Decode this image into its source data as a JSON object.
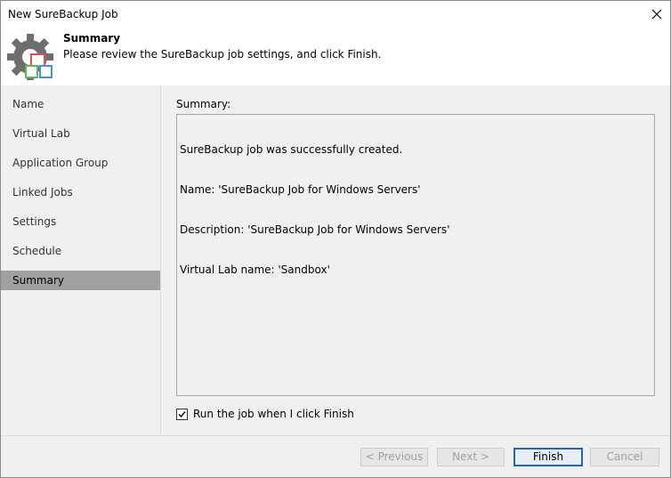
{
  "window": {
    "title": "New SureBackup Job"
  },
  "header": {
    "title": "Summary",
    "subtitle": "Please review the SureBackup job settings, and click Finish."
  },
  "sidebar": {
    "steps": [
      {
        "label": "Name"
      },
      {
        "label": "Virtual Lab"
      },
      {
        "label": "Application Group"
      },
      {
        "label": "Linked Jobs"
      },
      {
        "label": "Settings"
      },
      {
        "label": "Schedule"
      },
      {
        "label": "Summary",
        "active": true
      }
    ]
  },
  "main": {
    "summary_label": "Summary:",
    "summary_lines": [
      "SureBackup job was successfully created.",
      "Name: 'SureBackup Job for Windows Servers'",
      "Description: 'SureBackup Job for Windows Servers'",
      "Virtual Lab name: 'Sandbox'"
    ],
    "run_job": {
      "label": "Run the job when I click Finish",
      "checked": true
    }
  },
  "footer": {
    "previous_label": "< Previous",
    "next_label": "Next >",
    "finish_label": "Finish",
    "cancel_label": "Cancel"
  },
  "colors": {
    "active_step": "#a0a0a0",
    "panel_bg": "#f0f0f0",
    "primary_border": "#2a62b3"
  }
}
